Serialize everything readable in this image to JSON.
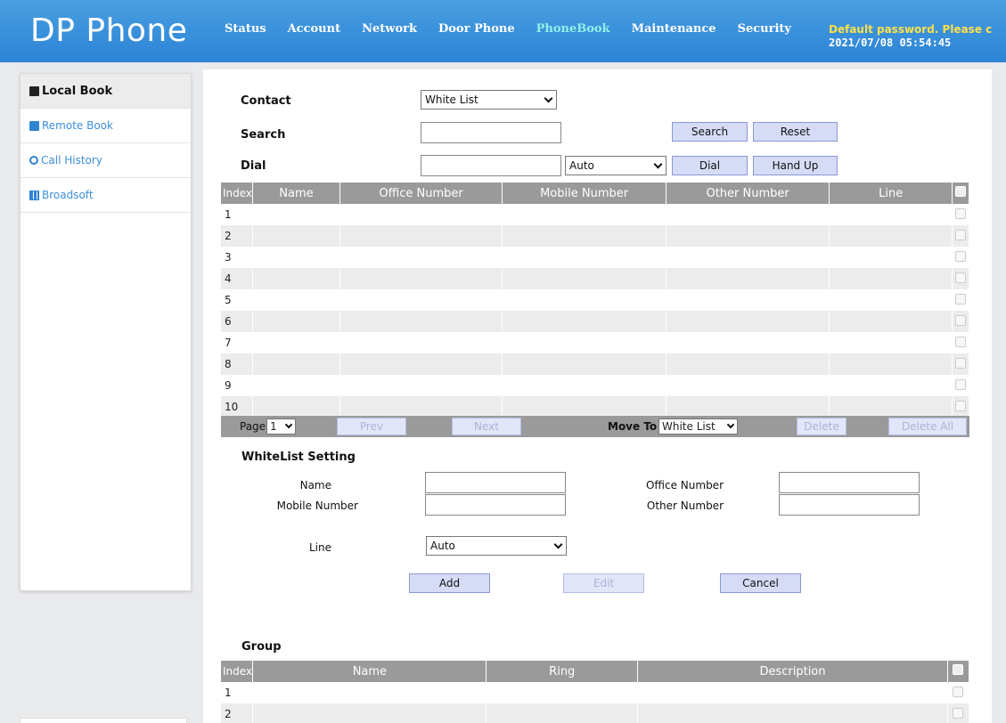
{
  "header": {
    "logo": "DP Phone",
    "nav": [
      "Status",
      "Account",
      "Network",
      "Door Phone",
      "PhoneBook",
      "Maintenance",
      "Security"
    ],
    "active_nav": "PhoneBook",
    "warning": "Default password. Please c",
    "datetime": "2021/07/08 05:54:45"
  },
  "sidebar": {
    "items": [
      {
        "label": "Local Book",
        "icon": "book-icon"
      },
      {
        "label": "Remote Book",
        "icon": "book-icon"
      },
      {
        "label": "Call History",
        "icon": "clock-icon"
      },
      {
        "label": "Broadsoft",
        "icon": "grid-icon"
      }
    ]
  },
  "form": {
    "contact_label": "Contact",
    "contact_value": "White List",
    "search_label": "Search",
    "search_value": "",
    "search_button": "Search",
    "reset_button": "Reset",
    "dial_label": "Dial",
    "dial_value": "",
    "dial_mode": "Auto",
    "dial_button": "Dial",
    "hangup_button": "Hand Up"
  },
  "contacts_table": {
    "columns": [
      "Index",
      "Name",
      "Office Number",
      "Mobile Number",
      "Other Number",
      "Line"
    ],
    "rows": [
      "1",
      "2",
      "3",
      "4",
      "5",
      "6",
      "7",
      "8",
      "9",
      "10"
    ]
  },
  "pager": {
    "page_label": "Page",
    "page_value": "1",
    "prev": "Prev",
    "next": "Next",
    "move_to_label": "Move To",
    "move_to_value": "White List",
    "delete": "Delete",
    "delete_all": "Delete All"
  },
  "whitelist": {
    "title": "WhiteList Setting",
    "name_label": "Name",
    "office_label": "Office Number",
    "mobile_label": "Mobile Number",
    "other_label": "Other Number",
    "line_label": "Line",
    "line_value": "Auto",
    "add": "Add",
    "edit": "Edit",
    "cancel": "Cancel"
  },
  "group": {
    "title": "Group",
    "columns": [
      "Index",
      "Name",
      "Ring",
      "Description"
    ],
    "rows": [
      "1",
      "2"
    ]
  }
}
